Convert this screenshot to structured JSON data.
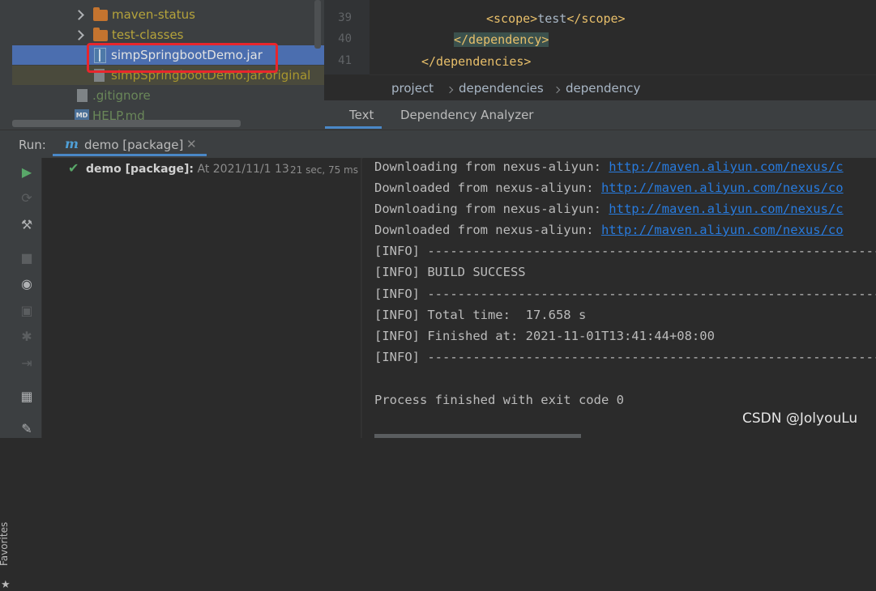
{
  "project_tree": {
    "items": [
      {
        "label": "maven-status",
        "kind": "folder",
        "color": "#b5a33b"
      },
      {
        "label": "test-classes",
        "kind": "folder",
        "color": "#b5a33b"
      },
      {
        "label": "simpSpringbootDemo.jar",
        "kind": "jar",
        "color": "#d4d4d4",
        "selected": true
      },
      {
        "label": "simpSpringbootDemo.jar.original",
        "kind": "file",
        "color": "#a8962e"
      },
      {
        "label": ".gitignore",
        "kind": "file",
        "color": "#6a8759"
      },
      {
        "label": "HELP.md",
        "kind": "markdown",
        "color": "#6a8759"
      }
    ]
  },
  "editor": {
    "line_numbers": [
      "39",
      "40",
      "41"
    ],
    "lines": [
      {
        "open": "<scope>",
        "text": "test",
        "close": "</scope>"
      },
      {
        "open": "</dependency>",
        "text": "",
        "close": ""
      },
      {
        "open": "</dependencies>",
        "text": "",
        "close": ""
      }
    ],
    "breadcrumb": [
      "project",
      "dependencies",
      "dependency"
    ],
    "bottom_tabs": [
      "Text",
      "Dependency Analyzer"
    ]
  },
  "run_window": {
    "label": "Run:",
    "tab_label": "demo [package]",
    "tab_icon": "m",
    "node_title": "demo [package]:",
    "node_timestamp": "At 2021/11/1 13",
    "node_duration": "21 sec, 75 ms"
  },
  "console": {
    "lines": [
      {
        "text": "Downloading from nexus-aliyun: ",
        "link": "http://maven.aliyun.com/nexus/c"
      },
      {
        "text": "Downloaded from nexus-aliyun: ",
        "link": "http://maven.aliyun.com/nexus/co"
      },
      {
        "text": "Downloading from nexus-aliyun: ",
        "link": "http://maven.aliyun.com/nexus/c"
      },
      {
        "text": "Downloaded from nexus-aliyun: ",
        "link": "http://maven.aliyun.com/nexus/co"
      },
      {
        "text": "[INFO] ----------------------------------------------------------------",
        "link": ""
      },
      {
        "text": "[INFO] BUILD SUCCESS",
        "link": ""
      },
      {
        "text": "[INFO] ----------------------------------------------------------------",
        "link": ""
      },
      {
        "text": "[INFO] Total time:  17.658 s",
        "link": ""
      },
      {
        "text": "[INFO] Finished at: 2021-11-01T13:41:44+08:00",
        "link": ""
      },
      {
        "text": "[INFO] ----------------------------------------------------------------",
        "link": ""
      },
      {
        "text": "",
        "link": ""
      },
      {
        "text": "Process finished with exit code 0",
        "link": ""
      }
    ]
  },
  "side_labels": {
    "favorites": "Favorites"
  },
  "watermark": "CSDN @JolyouLu",
  "colors": {
    "accent": "#4a88c7",
    "selection": "#4b6eaf",
    "highlight_box": "#e8262c",
    "success": "#59a869",
    "link": "#287bde"
  }
}
